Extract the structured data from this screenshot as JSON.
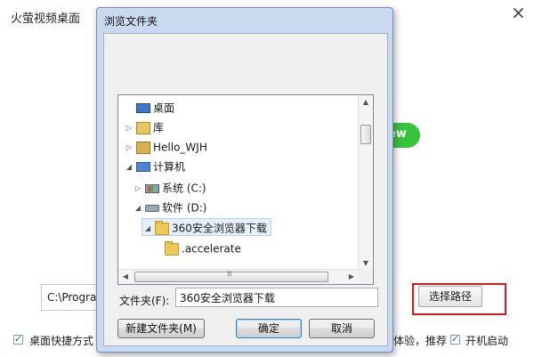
{
  "background_window": {
    "title": "火萤视频桌面",
    "close_glyph": "×",
    "green_pill_text": "ew",
    "install_path": "C:\\Progra",
    "select_path_button": "选择路径",
    "options": {
      "desktop_shortcut": "桌面快捷方式",
      "experience_recommend": "体验，推荐",
      "startup": "开机启动"
    }
  },
  "highlight_color": "#e0141b",
  "dialog": {
    "title": "浏览文件夹",
    "tree": [
      {
        "label": "桌面",
        "icon": "desktop-icon",
        "arrow": ""
      },
      {
        "label": "库",
        "icon": "library-icon",
        "arrow": "▷"
      },
      {
        "label": "Hello_WJH",
        "icon": "user-folder-icon",
        "arrow": "▷"
      },
      {
        "label": "计算机",
        "icon": "computer-icon",
        "arrow": "◢"
      },
      {
        "label": "系统 (C:)",
        "icon": "system-drive-icon",
        "arrow": "▷"
      },
      {
        "label": "软件 (D:)",
        "icon": "drive-icon",
        "arrow": "◢"
      },
      {
        "label": "360安全浏览器下载",
        "icon": "folder-icon",
        "arrow": "◢",
        "selected": true
      },
      {
        "label": ".accelerate",
        "icon": "folder-icon",
        "arrow": ""
      }
    ],
    "folder_label": "文件夹(F):",
    "folder_value": "360安全浏览器下载",
    "buttons": {
      "new_folder": "新建文件夹(M)",
      "ok": "确定",
      "cancel": "取消"
    }
  }
}
